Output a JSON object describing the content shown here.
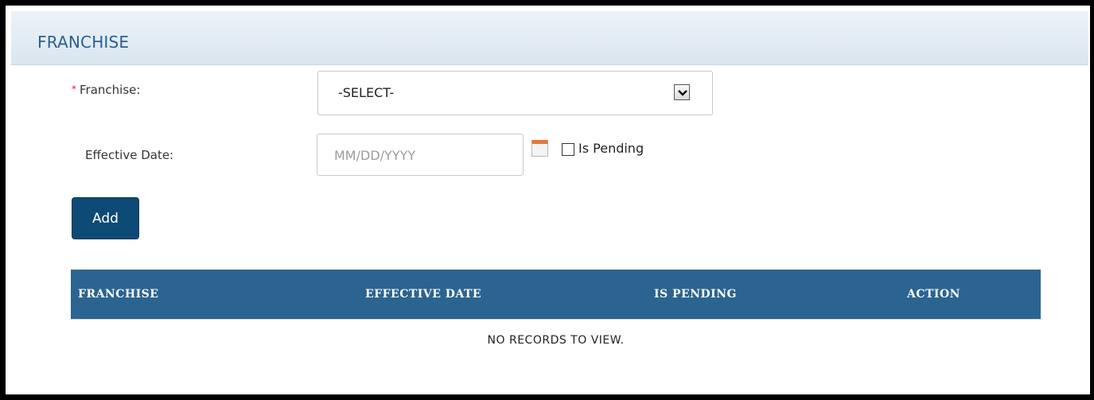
{
  "panel": {
    "title": "FRANCHISE"
  },
  "form": {
    "franchise_label": "Franchise:",
    "franchise_required_marker": "*",
    "franchise_select_value": "-SELECT-",
    "effective_date_label": "Effective Date:",
    "effective_date_placeholder": "MM/DD/YYYY",
    "is_pending_label": "Is Pending",
    "is_pending_checked": false,
    "add_button_label": "Add"
  },
  "grid": {
    "columns": [
      "FRANCHISE",
      "EFFECTIVE DATE",
      "IS PENDING",
      "ACTION"
    ],
    "rows": [],
    "empty_message": "NO RECORDS TO VIEW."
  },
  "icons": {
    "select_arrow": "chevron-down-icon",
    "calendar": "calendar-icon"
  },
  "colors": {
    "header_text": "#2a5f93",
    "grid_header_bg": "#2b6491",
    "button_bg": "#0d4b76",
    "required": "#e4162a"
  }
}
